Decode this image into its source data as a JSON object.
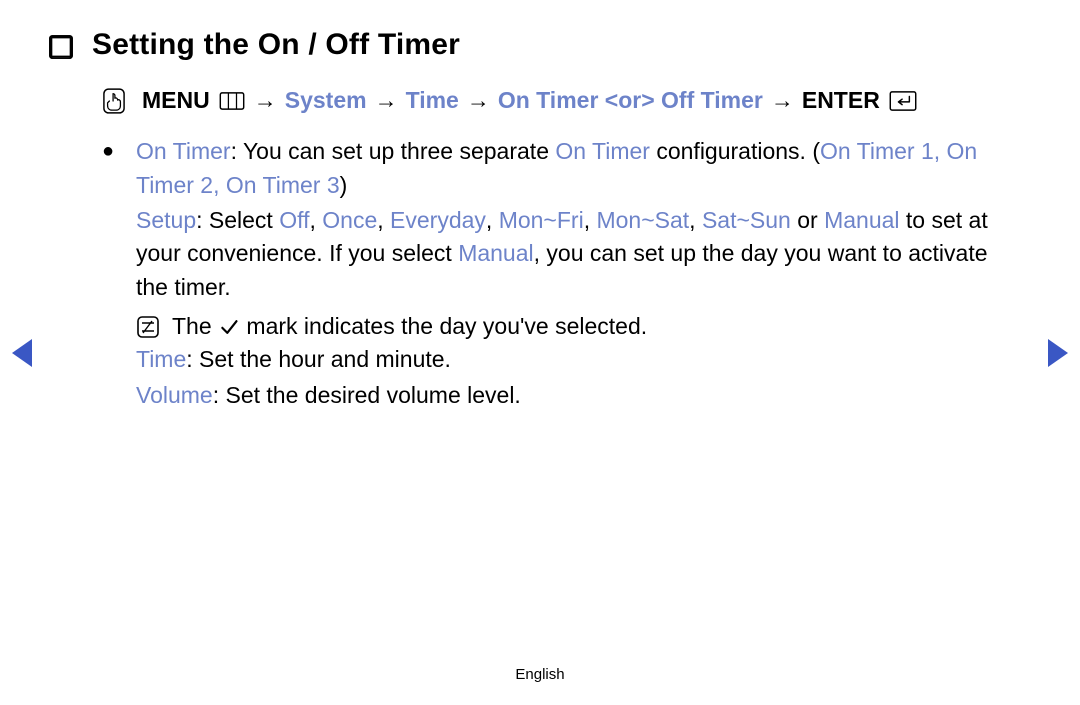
{
  "title": "Setting the On / Off Timer",
  "nav": {
    "menu_label": "MENU",
    "path": [
      "System",
      "Time",
      "On Timer <or> Off Timer"
    ],
    "enter_label": "ENTER",
    "arrow": "→"
  },
  "body": {
    "on_timer_label": "On Timer",
    "on_timer_desc_1": ": You can set up three separate ",
    "on_timer_desc_2": "On Timer",
    "on_timer_desc_3": " configurations. (",
    "on_timer_list": "On Timer 1, On Timer 2, On Timer 3",
    "on_timer_desc_4": ")",
    "setup_label": "Setup",
    "setup_1": ": Select ",
    "setup_opts": [
      "Off",
      "Once",
      "Everyday",
      "Mon~Fri",
      "Mon~Sat",
      "Sat~Sun"
    ],
    "setup_or": " or ",
    "setup_manual": "Manual",
    "setup_2": " to set at your convenience. If you select ",
    "setup_manual2": "Manual",
    "setup_3": ", you can set up the day you want to activate the timer.",
    "note_pre": "The ",
    "note_post": " mark indicates the day you've selected.",
    "time_label": "Time",
    "time_desc": ": Set the hour and minute.",
    "volume_label": "Volume",
    "volume_desc": ": Set the desired volume level."
  },
  "footer": {
    "lang": "English"
  }
}
